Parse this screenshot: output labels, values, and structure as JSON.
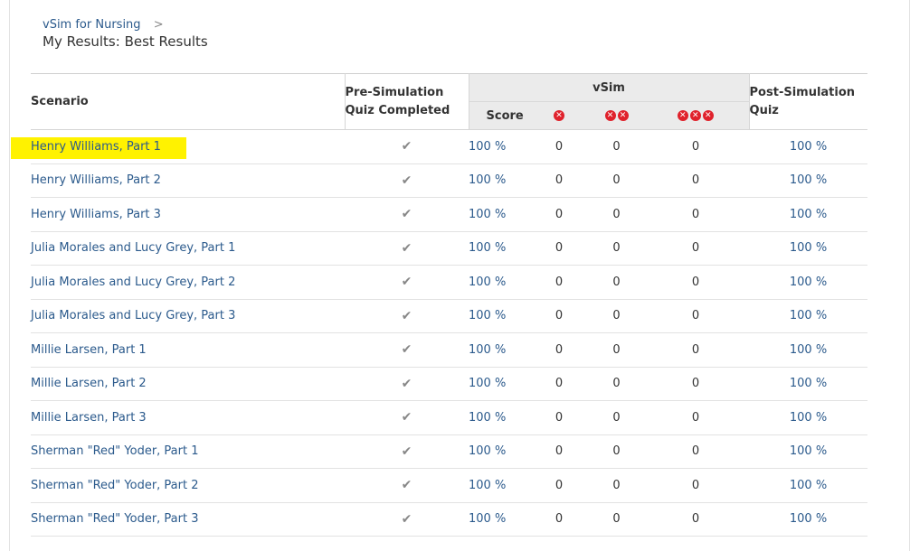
{
  "breadcrumb": {
    "link": "vSim for Nursing",
    "separator": ">"
  },
  "page_title": "My Results: Best Results",
  "table": {
    "headers": {
      "scenario": "Scenario",
      "pre_line1": "Pre-Simulation",
      "pre_line2": "Quiz Completed",
      "vsim": "vSim",
      "score": "Score",
      "post_line1": "Post-Simulation",
      "post_line2": "Quiz",
      "error_icon_glyph": "✕"
    },
    "check_glyph": "✔",
    "rows": [
      {
        "scenario": "Henry Williams, Part 1",
        "score": "100 %",
        "e1": "0",
        "e2": "0",
        "e3": "0",
        "post": "100 %"
      },
      {
        "scenario": "Henry Williams, Part 2",
        "score": "100 %",
        "e1": "0",
        "e2": "0",
        "e3": "0",
        "post": "100 %"
      },
      {
        "scenario": "Henry Williams, Part 3",
        "score": "100 %",
        "e1": "0",
        "e2": "0",
        "e3": "0",
        "post": "100 %"
      },
      {
        "scenario": "Julia Morales and Lucy Grey, Part 1",
        "score": "100 %",
        "e1": "0",
        "e2": "0",
        "e3": "0",
        "post": "100 %"
      },
      {
        "scenario": "Julia Morales and Lucy Grey, Part 2",
        "score": "100 %",
        "e1": "0",
        "e2": "0",
        "e3": "0",
        "post": "100 %"
      },
      {
        "scenario": "Julia Morales and Lucy Grey, Part 3",
        "score": "100 %",
        "e1": "0",
        "e2": "0",
        "e3": "0",
        "post": "100 %"
      },
      {
        "scenario": "Millie Larsen, Part 1",
        "score": "100 %",
        "e1": "0",
        "e2": "0",
        "e3": "0",
        "post": "100 %"
      },
      {
        "scenario": "Millie Larsen, Part 2",
        "score": "100 %",
        "e1": "0",
        "e2": "0",
        "e3": "0",
        "post": "100 %"
      },
      {
        "scenario": "Millie Larsen, Part 3",
        "score": "100 %",
        "e1": "0",
        "e2": "0",
        "e3": "0",
        "post": "100 %"
      },
      {
        "scenario": "Sherman \"Red\" Yoder, Part 1",
        "score": "100 %",
        "e1": "0",
        "e2": "0",
        "e3": "0",
        "post": "100 %"
      },
      {
        "scenario": "Sherman \"Red\" Yoder, Part 2",
        "score": "100 %",
        "e1": "0",
        "e2": "0",
        "e3": "0",
        "post": "100 %"
      },
      {
        "scenario": "Sherman \"Red\" Yoder, Part 3",
        "score": "100 %",
        "e1": "0",
        "e2": "0",
        "e3": "0",
        "post": "100 %"
      }
    ]
  },
  "colors": {
    "link": "#2b5a8c",
    "error_icon": "#e0222c",
    "highlight": "#fff200",
    "vsim_header_bg": "#ebebeb"
  }
}
